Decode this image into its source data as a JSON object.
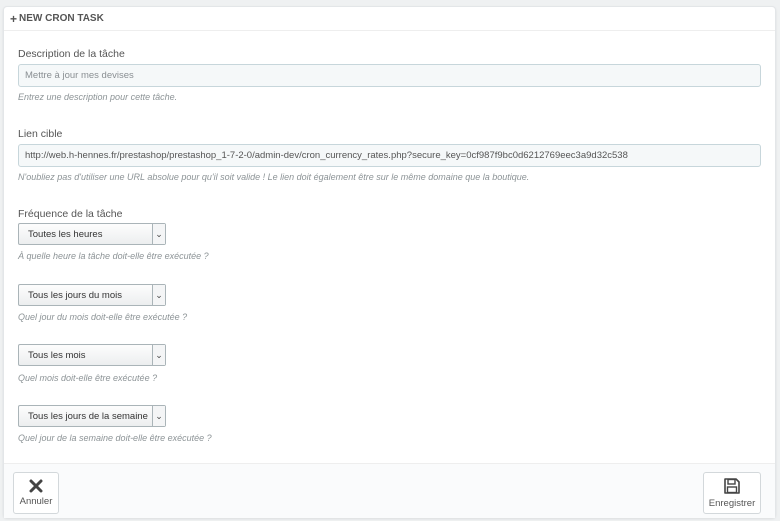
{
  "panel": {
    "title": "NEW CRON TASK"
  },
  "description": {
    "label": "Description de la tâche",
    "placeholder": "Mettre à jour mes devises",
    "help": "Entrez une description pour cette tâche."
  },
  "target_link": {
    "label": "Lien cible",
    "value": "http://web.h-hennes.fr/prestashop/prestashop_1-7-2-0/admin-dev/cron_currency_rates.php?secure_key=0cf987f9bc0d6212769eec3a9d32c538",
    "help": "N'oubliez pas d'utiliser une URL absolue pour qu'il soit valide ! Le lien doit également être sur le même domaine que la boutique."
  },
  "frequency": {
    "label": "Fréquence de la tâche",
    "hour": {
      "selected": "Toutes les heures",
      "help": "À quelle heure la tâche doit-elle être exécutée ?"
    },
    "day": {
      "selected": "Tous les jours du mois",
      "help": "Quel jour du mois doit-elle être exécutée ?"
    },
    "month": {
      "selected": "Tous les mois",
      "help": "Quel mois doit-elle être exécutée ?"
    },
    "weekday": {
      "selected": "Tous les jours de la semaine",
      "help": "Quel jour de la semaine doit-elle être exécutée ?"
    }
  },
  "footer": {
    "cancel_label": "Annuler",
    "save_label": "Enregistrer"
  },
  "icons": {
    "heading": "plus-icon",
    "cancel": "close-icon",
    "save": "floppy-disk-icon"
  }
}
